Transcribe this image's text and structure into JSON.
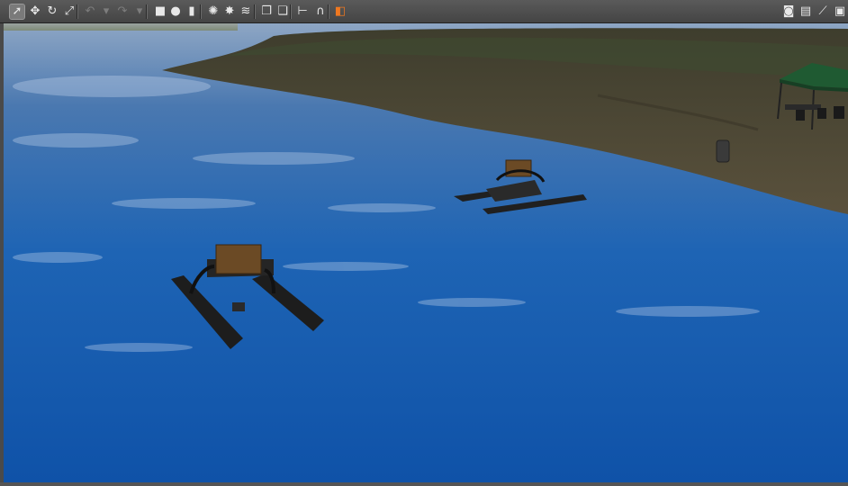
{
  "toolbar": {
    "left_tools": [
      {
        "name": "select-mode-icon",
        "glyph": "➚"
      },
      {
        "name": "translate-mode-icon",
        "glyph": "✥"
      },
      {
        "name": "rotate-mode-icon",
        "glyph": "↻"
      },
      {
        "name": "scale-mode-icon",
        "glyph": "⤢"
      },
      {
        "name": "undo-icon",
        "glyph": "↶"
      },
      {
        "name": "undo-dropdown-icon",
        "glyph": "▾"
      },
      {
        "name": "redo-icon",
        "glyph": "↷"
      },
      {
        "name": "redo-dropdown-icon",
        "glyph": "▾"
      },
      {
        "name": "box-shape-icon",
        "glyph": "■"
      },
      {
        "name": "sphere-shape-icon",
        "glyph": "●"
      },
      {
        "name": "cylinder-shape-icon",
        "glyph": "▮"
      },
      {
        "name": "point-light-icon",
        "glyph": "✺"
      },
      {
        "name": "spot-light-icon",
        "glyph": "✸"
      },
      {
        "name": "directional-light-icon",
        "glyph": "≋"
      },
      {
        "name": "copy-icon",
        "glyph": "❐"
      },
      {
        "name": "paste-icon",
        "glyph": "❏"
      },
      {
        "name": "align-icon",
        "glyph": "⊢"
      },
      {
        "name": "snap-icon",
        "glyph": "∩"
      },
      {
        "name": "change-view-icon",
        "glyph": "◧"
      }
    ],
    "right_tools": [
      {
        "name": "screenshot-icon",
        "glyph": "◙"
      },
      {
        "name": "log-icon",
        "glyph": "▤"
      },
      {
        "name": "plot-icon",
        "glyph": "⟋"
      },
      {
        "name": "record-video-icon",
        "glyph": "▣"
      }
    ],
    "accent_color": "#f07820"
  },
  "scene": {
    "water_color": "#1a5fae",
    "shore_color": "#4a4535",
    "canopy_color": "#1f5a32"
  }
}
